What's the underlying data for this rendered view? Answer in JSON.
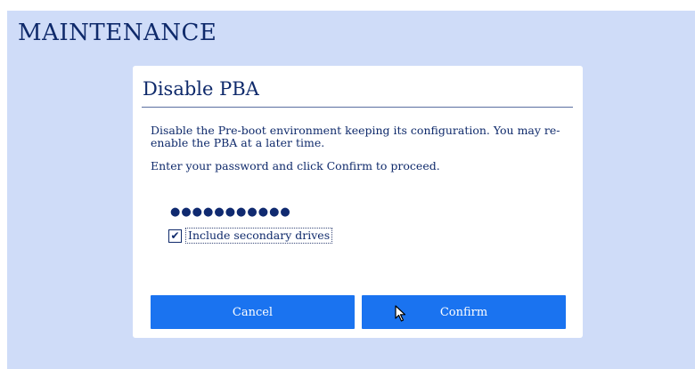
{
  "page": {
    "title": "MAINTENANCE"
  },
  "dialog": {
    "title": "Disable PBA",
    "message": "Disable the Pre-boot environment keeping its configuration. You may re-enable the PBA at a later time.",
    "instruction": "Enter your password and click Confirm to proceed.",
    "password": {
      "masked_value": "●●●●●●●●●●●"
    },
    "secondary_drives": {
      "label": "Include secondary drives",
      "checked": true,
      "check_glyph": "✔"
    },
    "buttons": {
      "cancel_label": "Cancel",
      "confirm_label": "Confirm"
    }
  },
  "icons": {
    "check": "check-icon",
    "cursor": "mouse-pointer-icon"
  },
  "colors": {
    "background": "#cfdcf8",
    "dialog_bg": "#ffffff",
    "text": "#0f2a6b",
    "button": "#1a73f0",
    "button_text": "#ffffff"
  }
}
